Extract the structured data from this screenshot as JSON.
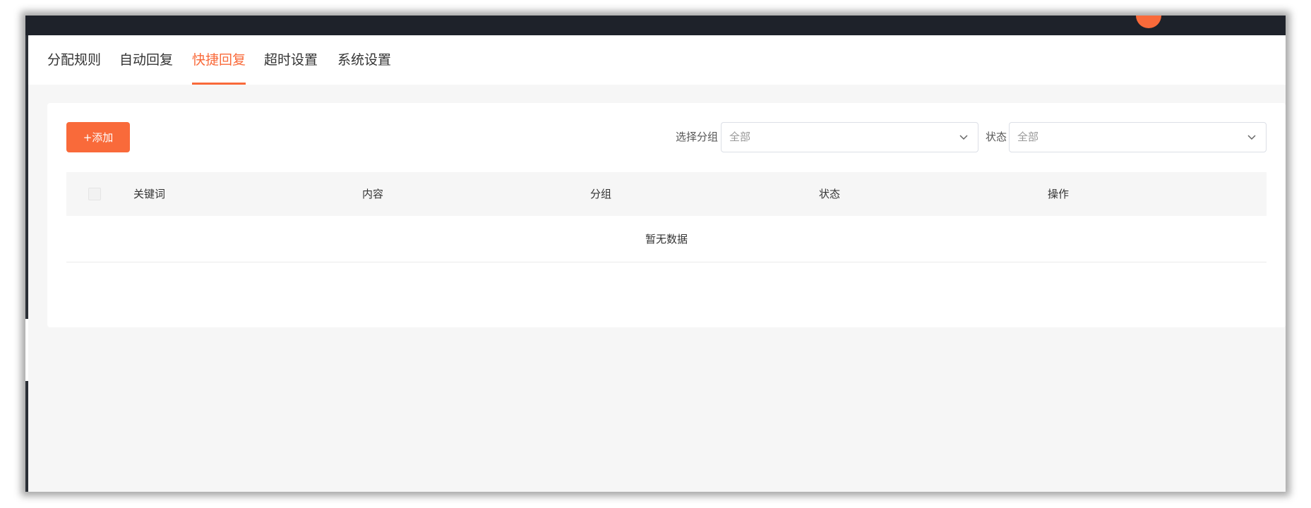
{
  "tabs": [
    {
      "label": "分配规则",
      "active": false
    },
    {
      "label": "自动回复",
      "active": false
    },
    {
      "label": "快捷回复",
      "active": true
    },
    {
      "label": "超时设置",
      "active": false
    },
    {
      "label": "系统设置",
      "active": false
    }
  ],
  "toolbar": {
    "add_label": "+添加",
    "group_filter_label": "选择分组",
    "group_filter_value": "全部",
    "status_filter_label": "状态",
    "status_filter_value": "全部"
  },
  "table": {
    "columns": [
      "关键词",
      "内容",
      "分组",
      "状态",
      "操作"
    ],
    "empty_text": "暂无数据"
  },
  "colors": {
    "accent": "#f96a3a",
    "topbar": "#1e222a",
    "page_bg": "#f6f6f6"
  },
  "icons": {
    "select_arrow": "chevron-down-icon"
  }
}
